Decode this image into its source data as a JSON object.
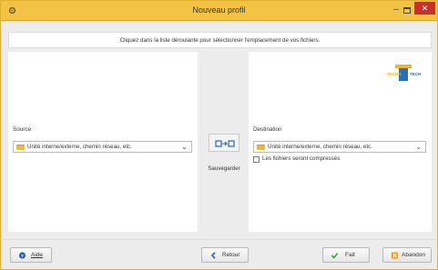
{
  "window": {
    "title": "Nouveau profil"
  },
  "instructions": "Cliquez dans la liste déroulante pour sélectionner l'emplacement de vos fichiers.",
  "source": {
    "label": "Source",
    "value": "Unité interne/externe, chemin réseau, etc."
  },
  "destination": {
    "label": "Destination",
    "value": "Unité interne/externe, chemin réseau, etc.",
    "compress_label": "Les fichiers seront compressés",
    "compress_checked": false
  },
  "save": {
    "label": "Sauvegarder"
  },
  "logo": {
    "text_left": "TECHN",
    "text_right": "TECH"
  },
  "footer": {
    "help_label": "Aide",
    "back_label": "Retour",
    "done_label": "Fait",
    "cancel_label": "Abandon"
  },
  "colors": {
    "titlebar": "#f3c343",
    "close": "#c9302c",
    "check": "#3aa53a",
    "back_arrow": "#2a62b8"
  }
}
